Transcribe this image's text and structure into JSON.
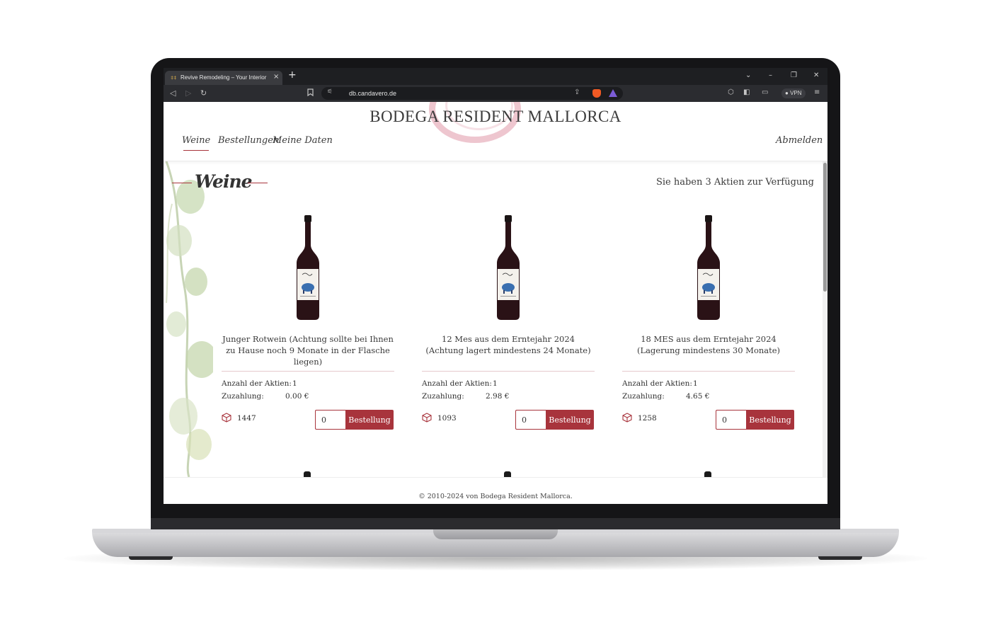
{
  "browser": {
    "tab_title": "Revive Remodeling – Your Interior",
    "new_tab": "+",
    "tab_close": "×",
    "url": "db.candavero.de",
    "vpn_label": "VPN",
    "controls": {
      "chevron": "⌄",
      "minimize": "–",
      "restore": "❐",
      "close": "✕"
    },
    "icons": [
      "back-icon",
      "forward-icon",
      "reload-icon",
      "bookmark-icon",
      "site-settings-icon",
      "share-icon",
      "brave-shields-icon",
      "brave-rewards-icon",
      "extensions-icon",
      "sidebar-icon",
      "wallet-icon",
      "menu-icon"
    ]
  },
  "site": {
    "brand": "BODEGA RESIDENT MALLORCA",
    "nav": [
      "Weine",
      "Bestellungen",
      "Meine Daten"
    ],
    "logout": "Abmelden",
    "accent_color": "#a8343c"
  },
  "main": {
    "section_title": "Weine",
    "shares_available": "Sie haben 3 Aktien zur Verfügung",
    "wines": [
      {
        "name": "Junger Rotwein (Achtung sollte bei Ihnen zu Hause noch 9 Monate in der Flasche liegen)",
        "shares_label": "Anzahl der Aktien:",
        "shares_value": "1",
        "surcharge_label": "Zuzahlung:",
        "surcharge_value": "0.00 €",
        "stock": "1447",
        "quantity": "0",
        "button": "Bestellung"
      },
      {
        "name": "12 Mes aus dem Erntejahr 2024 (Achtung lagert mindestens 24 Monate)",
        "shares_label": "Anzahl der Aktien:",
        "shares_value": "1",
        "surcharge_label": "Zuzahlung:",
        "surcharge_value": "2.98 €",
        "stock": "1093",
        "quantity": "0",
        "button": "Bestellung"
      },
      {
        "name": "18 MES aus dem Erntejahr 2024 (Lagerung mindestens 30 Monate)",
        "shares_label": "Anzahl der Aktien:",
        "shares_value": "1",
        "surcharge_label": "Zuzahlung:",
        "surcharge_value": "4.65 €",
        "stock": "1258",
        "quantity": "0",
        "button": "Bestellung"
      }
    ]
  },
  "footer": {
    "copyright": "© 2010-2024 von Bodega Resident Mallorca."
  }
}
